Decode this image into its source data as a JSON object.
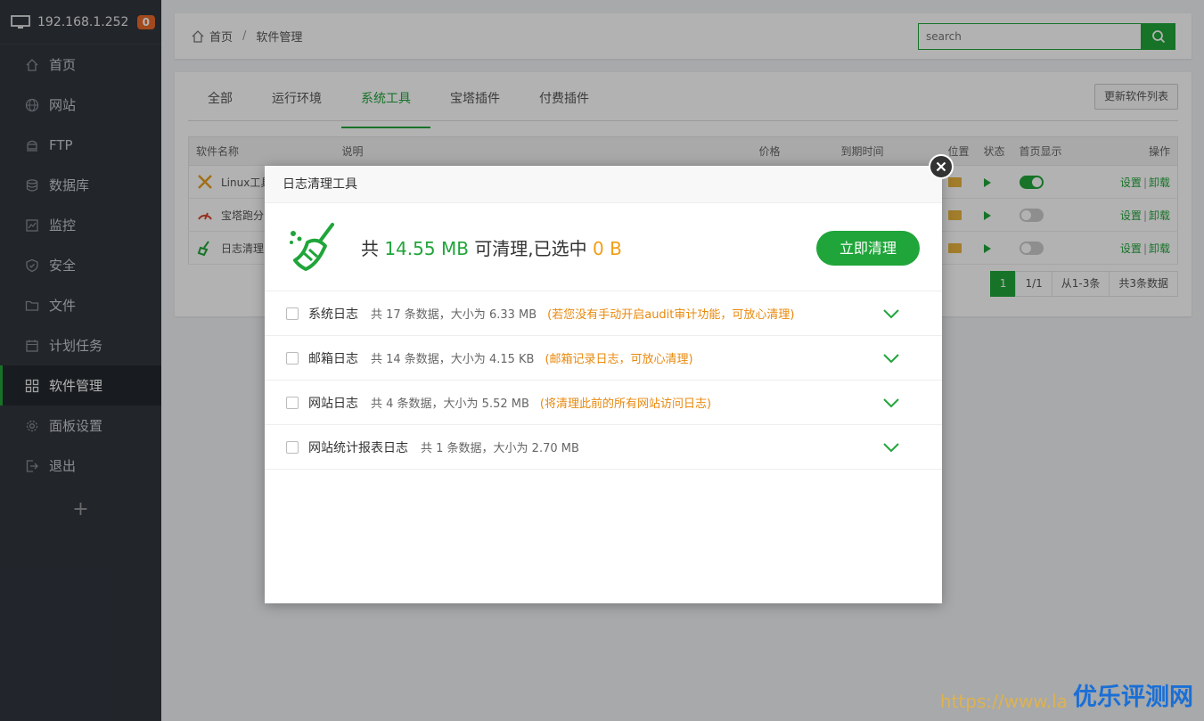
{
  "sidebar": {
    "host": "192.168.1.252",
    "badge": "0",
    "items": [
      {
        "label": "首页",
        "icon": "home-icon"
      },
      {
        "label": "网站",
        "icon": "globe-icon"
      },
      {
        "label": "FTP",
        "icon": "ftp-icon"
      },
      {
        "label": "数据库",
        "icon": "database-icon"
      },
      {
        "label": "监控",
        "icon": "monitor-icon"
      },
      {
        "label": "安全",
        "icon": "shield-icon"
      },
      {
        "label": "文件",
        "icon": "folder-icon"
      },
      {
        "label": "计划任务",
        "icon": "calendar-icon"
      },
      {
        "label": "软件管理",
        "icon": "apps-icon"
      },
      {
        "label": "面板设置",
        "icon": "gear-icon"
      },
      {
        "label": "退出",
        "icon": "logout-icon"
      }
    ],
    "add_label": "+"
  },
  "header": {
    "crumb_home": "首页",
    "crumb_sep": "/",
    "crumb_current": "软件管理",
    "search_placeholder": "search"
  },
  "tabs": [
    "全部",
    "运行环境",
    "系统工具",
    "宝塔插件",
    "付费插件"
  ],
  "refresh_label": "更新软件列表",
  "table": {
    "headers": [
      "软件名称",
      "说明",
      "价格",
      "到期时间",
      "位置",
      "状态",
      "首页显示",
      "操作"
    ],
    "rows": [
      {
        "name": "Linux工具",
        "show_home": true
      },
      {
        "name": "宝塔跑分",
        "show_home": false
      },
      {
        "name": "日志清理",
        "show_home": false
      }
    ],
    "op_set": "设置",
    "op_sep": "|",
    "op_uninstall": "卸载"
  },
  "pager": [
    "1",
    "1/1",
    "从1-3条",
    "共3条数据"
  ],
  "modal": {
    "title": "日志清理工具",
    "summary_prefix": "共",
    "total": "14.55 MB",
    "summary_mid": "可清理,已选中",
    "selected": "0 B",
    "clean_button": "立即清理",
    "logs": [
      {
        "name": "系统日志",
        "info": "共 17 条数据，大小为 6.33 MB",
        "tip": "(若您没有手动开启audit审计功能，可放心清理)"
      },
      {
        "name": "邮箱日志",
        "info": "共 14 条数据，大小为 4.15 KB",
        "tip": "(邮箱记录日志，可放心清理)"
      },
      {
        "name": "网站日志",
        "info": "共 4 条数据，大小为 5.52 MB",
        "tip": "(将清理此前的所有网站访问日志)"
      },
      {
        "name": "网站统计报表日志",
        "info": "共 1 条数据，大小为 2.70 MB",
        "tip": ""
      }
    ]
  },
  "watermark": {
    "url": "https://www.la",
    "brand": "优乐评测网"
  },
  "colors": {
    "accent": "#20a53a",
    "sidebar_bg": "#31353d",
    "badge": "#e8692a",
    "warning": "#f39c12"
  }
}
